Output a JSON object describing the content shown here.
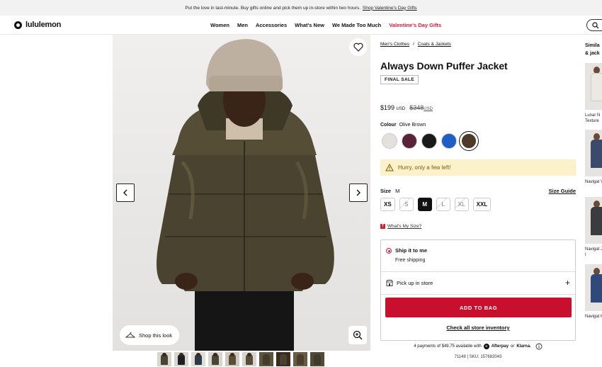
{
  "promo": {
    "text": "Put the love in last-minute. Buy gifts online and pick them up in-store within two hours.",
    "link": "Shop Valentine's Day Gifts"
  },
  "nav": {
    "logo": "lululemon",
    "menu": [
      "Women",
      "Men",
      "Accessories",
      "What's New",
      "We Made Too Much",
      "Valentine's Day Gifts"
    ]
  },
  "gallery": {
    "shop_look": "Shop this look",
    "thumb_count": 10
  },
  "product": {
    "breadcrumbs": [
      "Men's Clothes",
      "Coats & Jackets"
    ],
    "breadcrumb_sep": "/",
    "title": "Always Down Puffer Jacket",
    "badge": "FINAL SALE",
    "price": "$199",
    "price_currency": "USD",
    "price_old": "$348",
    "price_old_currency": "USD",
    "colour_label": "Colour",
    "colour_value": "Olive Brown",
    "swatches": [
      "#e4e1dc",
      "#5a2238",
      "#1a1a1a",
      "#1f5fc4",
      "#4d3a2a"
    ],
    "stock_alert": "Hurry, only a few left!",
    "size_label": "Size",
    "size_value": "M",
    "size_guide": "Size Guide",
    "sizes": [
      {
        "label": "XS",
        "state": "available"
      },
      {
        "label": "S",
        "state": "unavailable"
      },
      {
        "label": "M",
        "state": "selected"
      },
      {
        "label": "L",
        "state": "unavailable"
      },
      {
        "label": "XL",
        "state": "unavailable"
      },
      {
        "label": "XXL",
        "state": "available"
      }
    ],
    "whats_my_size": "What's My Size?",
    "ship_title": "Ship it to me",
    "ship_sub": "Free shipping",
    "pickup": "Pick up in store",
    "add_to_bag": "ADD TO BAG",
    "check_inventory": "Check all store inventory",
    "pay_text": "4 payments of $49.75 available with",
    "pay_afterpay": "Afterpay",
    "pay_or": "or",
    "pay_klarna": "Klarna.",
    "sku": "71148 | SKU: 157682043"
  },
  "similar": {
    "heading": "Simila & jack",
    "items": [
      {
        "label": "Lunar N Texture",
        "color": "#ece9e4"
      },
      {
        "label": "Navigat Vest",
        "color": "#3a4a6a"
      },
      {
        "label": "Navigat Jacket I",
        "color": "#3b3c3d"
      },
      {
        "label": "Navigat Hoodie",
        "color": "#2f4a7a"
      }
    ]
  }
}
